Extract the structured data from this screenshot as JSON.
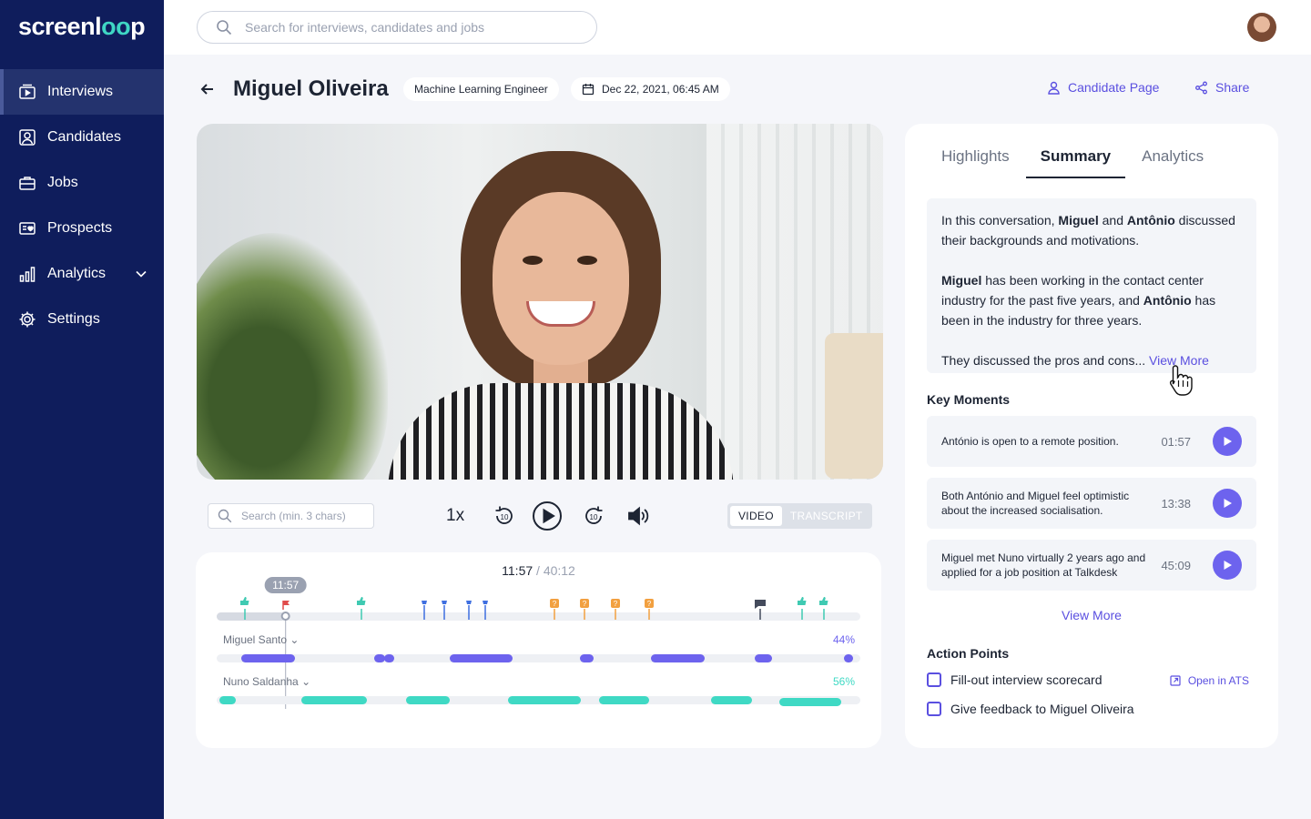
{
  "brand": {
    "name_prefix": "screenl",
    "name_x": "oo",
    "name_suffix": "p"
  },
  "sidebar": {
    "items": [
      {
        "label": "Interviews",
        "icon": "video-icon"
      },
      {
        "label": "Candidates",
        "icon": "candidate-icon"
      },
      {
        "label": "Jobs",
        "icon": "briefcase-icon"
      },
      {
        "label": "Prospects",
        "icon": "prospect-icon"
      },
      {
        "label": "Analytics",
        "icon": "bar-chart-icon"
      },
      {
        "label": "Settings",
        "icon": "gear-icon"
      }
    ]
  },
  "topbar": {
    "search_placeholder": "Search for interviews, candidates and jobs"
  },
  "header": {
    "candidate_name": "Miguel Oliveira",
    "job_title": "Machine Learning Engineer",
    "date": "Dec 22, 2021, 06:45 AM",
    "candidate_page_label": "Candidate Page",
    "share_label": "Share"
  },
  "player": {
    "search_placeholder": "Search (min. 3 chars)",
    "speed": "1x",
    "rewind_label": "10",
    "forward_label": "10",
    "toggle": {
      "video": "VIDEO",
      "transcript": "TRANSCRIPT"
    }
  },
  "timeline": {
    "current_time": "11:57",
    "separator": " / ",
    "duration": "40:12",
    "progress_fraction": 0.107,
    "speakers": [
      {
        "name": "Miguel Santo",
        "percent": "44%",
        "color": "#6d63ee"
      },
      {
        "name": "Nuno Saldanha",
        "percent": "56%",
        "color": "#3fd9c4"
      }
    ]
  },
  "panel": {
    "tabs": [
      "Highlights",
      "Summary",
      "Analytics"
    ],
    "active_tab": "Summary",
    "summary": {
      "p1_a": "In this conversation, ",
      "p1_b": "Miguel",
      "p1_c": " and ",
      "p1_d": "Antônio",
      "p1_e": " discussed their backgrounds and motivations.",
      "p2_a": "Miguel",
      "p2_b": " has been working in the contact center industry for the past five years, and ",
      "p2_c": "Antônio",
      "p2_d": " has been in the industry for three years.",
      "p3": "They discussed the pros and cons... ",
      "view_more": "View More"
    },
    "key_moments_title": "Key Moments",
    "key_moments": [
      {
        "text": "António is open to a remote position.",
        "time": "01:57"
      },
      {
        "text": "Both António and Miguel feel optimistic about the increased socialisation.",
        "time": "13:38"
      },
      {
        "text": "Miguel met Nuno virtually 2 years ago and applied for a job position at Talkdesk",
        "time": "45:09"
      }
    ],
    "key_moments_view_more": "View More",
    "action_points_title": "Action Points",
    "action_points": [
      {
        "text": "Fill-out interview scorecard",
        "checked": false
      },
      {
        "text": "Give feedback to Miguel Oliveira",
        "checked": false
      }
    ],
    "open_in_ats": "Open in ATS"
  },
  "colors": {
    "sidebar": "#0f1d5c",
    "accent": "#5a4fe0",
    "teal": "#3fd9c4",
    "purple": "#6d63ee"
  }
}
